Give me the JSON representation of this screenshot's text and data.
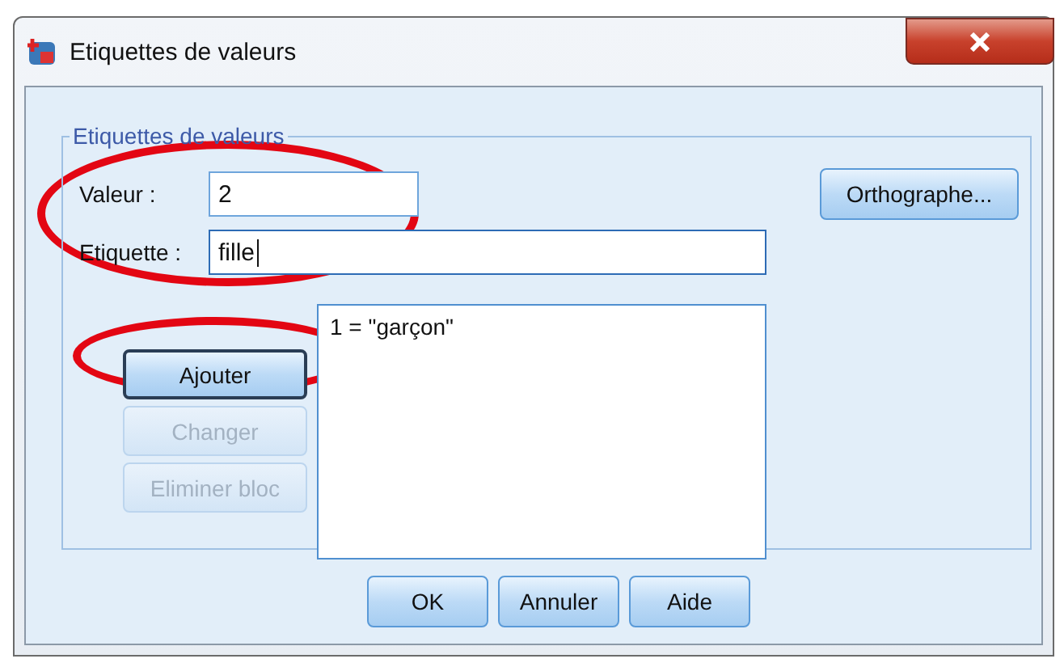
{
  "window": {
    "title": "Etiquettes de valeurs"
  },
  "group": {
    "legend": "Etiquettes de valeurs"
  },
  "fields": [
    {
      "label": "Valeur :",
      "value": "2",
      "focused": false
    },
    {
      "label": "Etiquette :",
      "value": "fille",
      "focused": true
    }
  ],
  "spell_button": {
    "label": "Orthographe..."
  },
  "side_buttons": [
    {
      "label": "Ajouter",
      "disabled": false,
      "default": true
    },
    {
      "label": "Changer",
      "disabled": true,
      "default": false
    },
    {
      "label": "Eliminer bloc",
      "disabled": true,
      "default": false
    }
  ],
  "list": {
    "items": [
      {
        "text": "1 = \"garçon\"",
        "selected": false
      }
    ]
  },
  "buttons": [
    {
      "label": "OK"
    },
    {
      "label": "Annuler"
    },
    {
      "label": "Aide"
    }
  ],
  "annotations": [
    {
      "kind": "ellipse"
    },
    {
      "kind": "ellipse"
    }
  ]
}
